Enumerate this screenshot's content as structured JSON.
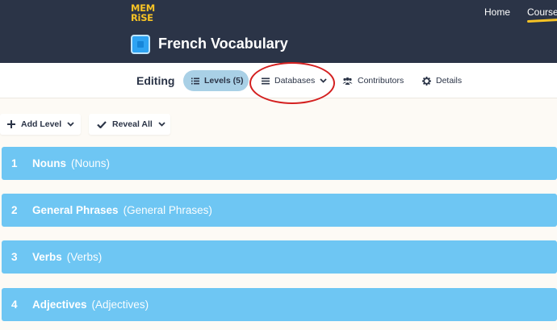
{
  "header": {
    "logo_line1": "MEM",
    "logo_line2": "RiSE",
    "nav": [
      {
        "label": "Home",
        "active": false
      },
      {
        "label": "Courses",
        "active": true
      }
    ],
    "course_title": "French Vocabulary"
  },
  "tabs_bar": {
    "editing_label": "Editing",
    "tabs": [
      {
        "label": "Levels (5)",
        "icon": "list-icon",
        "active": true
      },
      {
        "label": "Databases",
        "icon": "menu-icon",
        "has_dropdown": true
      },
      {
        "label": "Contributors",
        "icon": "users-icon"
      },
      {
        "label": "Details",
        "icon": "gear-icon"
      }
    ]
  },
  "actions": {
    "add_level": "Add Level",
    "reveal_all": "Reveal All"
  },
  "levels": [
    {
      "number": "1",
      "name": "Nouns",
      "sub": "(Nouns)"
    },
    {
      "number": "2",
      "name": "General Phrases",
      "sub": "(General Phrases)"
    },
    {
      "number": "3",
      "name": "Verbs",
      "sub": "(Verbs)"
    },
    {
      "number": "4",
      "name": "Adjectives",
      "sub": "(Adjectives)"
    }
  ],
  "colors": {
    "header_bg": "#2b3447",
    "accent_yellow": "#f7c325",
    "level_bg": "#6ec6f3",
    "levels_tab_bg": "#a9d0e6",
    "annotation_red": "#d42020"
  }
}
